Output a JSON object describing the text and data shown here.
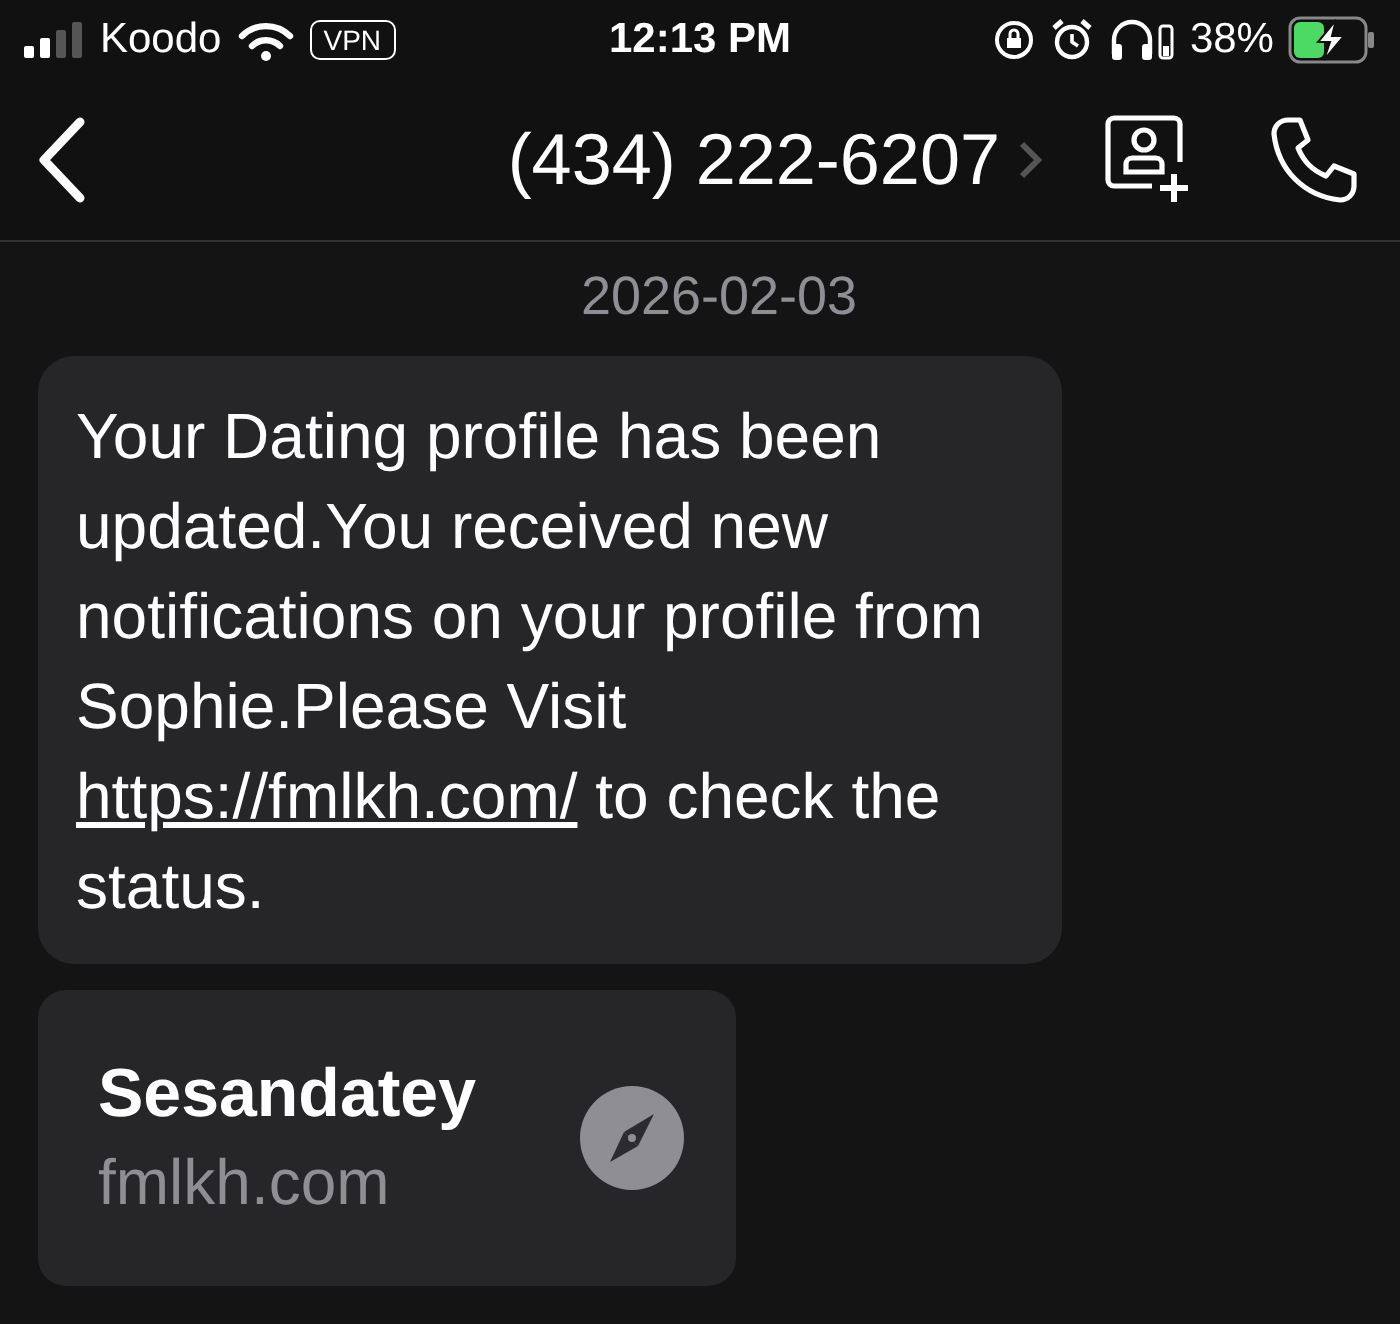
{
  "status_bar": {
    "carrier": "Koodo",
    "vpn": "VPN",
    "time": "12:13 PM",
    "battery_percent": "38%"
  },
  "header": {
    "contact": "(434) 222-6207"
  },
  "date": "2026-02-03",
  "message": {
    "text_before": "Your Dating profile has been updated.You received new notifications on your profile from Sophie.Please Visit ",
    "link": "https://fmlkh.com/",
    "text_after": " to check the status."
  },
  "link_preview": {
    "title": "Sesandatey",
    "domain": "fmlkh.com"
  }
}
